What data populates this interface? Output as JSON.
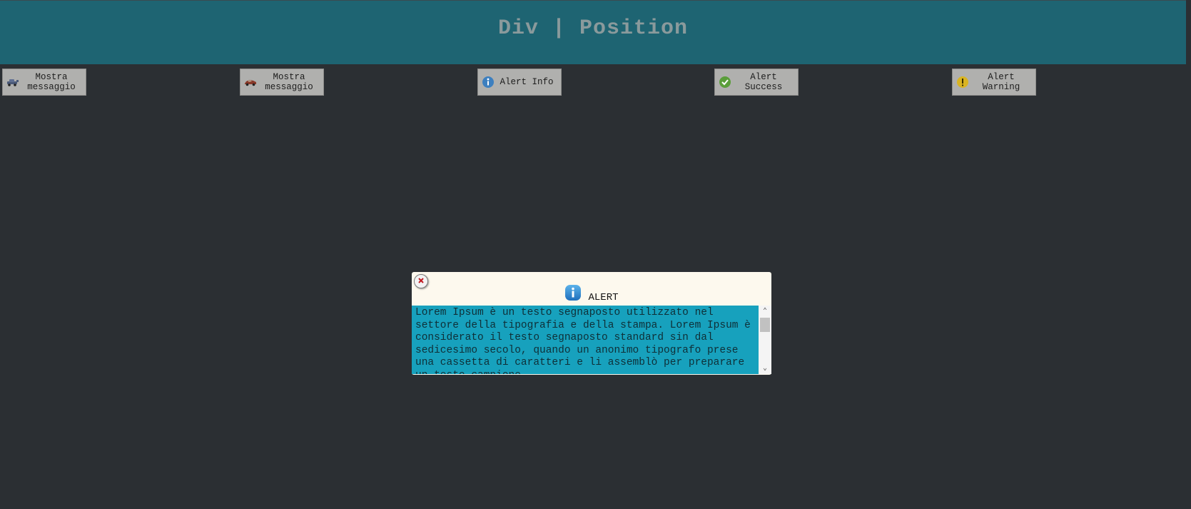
{
  "header": {
    "title": "Div | Position"
  },
  "toolbar": {
    "buttons": [
      {
        "label": "Mostra messaggio",
        "icon": "car-icon"
      },
      {
        "label": "Mostra messaggio",
        "icon": "sports-car-icon"
      },
      {
        "label": "Alert Info",
        "icon": "info-icon"
      },
      {
        "label": "Alert Success",
        "icon": "check-icon"
      },
      {
        "label": "Alert Warning",
        "icon": "warning-icon"
      }
    ]
  },
  "dialog": {
    "title": "ALERT",
    "icon": "info-icon",
    "message": "Lorem Ipsum è un testo segnaposto utilizzato nel settore della tipografia e della stampa. Lorem Ipsum è considerato il testo segnaposto standard sin dal sedicesimo secolo, quando un anonimo tipografo prese una cassetta di caratteri e li assemblò per preparare un testo campione."
  },
  "colors": {
    "background": "#2b2f33",
    "header": "#1e6472",
    "button": "#b0b0ae",
    "dialog": "#fdf9ee",
    "message_box": "#17a1bd"
  }
}
